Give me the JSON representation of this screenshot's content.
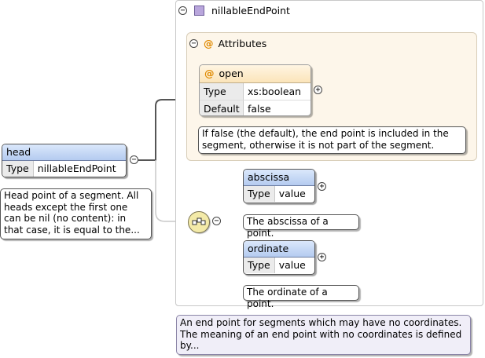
{
  "root_element": {
    "name": "nillableEndPoint"
  },
  "attributes_group": {
    "label": "Attributes"
  },
  "attribute_open": {
    "name": "open",
    "rows": [
      {
        "key": "Type",
        "value": "xs:boolean"
      },
      {
        "key": "Default",
        "value": "false"
      }
    ],
    "doc": "If false (the default), the end point is included in the segment, otherwise it is not part of the segment."
  },
  "head": {
    "name": "head",
    "type_key": "Type",
    "type_value": "nillableEndPoint",
    "doc_lines": [
      "Head point of a segment. All",
      "heads except the first one",
      "can be nil (no content): in",
      "that case, it is equal to the..."
    ]
  },
  "abscissa": {
    "name": "abscissa",
    "type_key": "Type",
    "type_value": "value",
    "doc": "The abscissa of a point."
  },
  "ordinate": {
    "name": "ordinate",
    "type_key": "Type",
    "type_value": "value",
    "doc": "The ordinate of a point."
  },
  "root_doc_lines": [
    "An end point for segments which may have no coordinates.",
    "The meaning of an end point with no coordinates is defined",
    "by..."
  ],
  "icons": {
    "collapse": "minus-circle",
    "expand": "plus-circle",
    "attribute": "at-sign",
    "element": "purple-square",
    "sequence": "sequence-compositor"
  },
  "colors": {
    "element_header": "#c7d9f6",
    "attribute_header": "#fbe9c6",
    "attribute_marker": "#e08a00",
    "element_icon": "#b9a6dc",
    "sequence_badge": "#f3eaa8",
    "root_note_bg": "#f0eef8"
  }
}
